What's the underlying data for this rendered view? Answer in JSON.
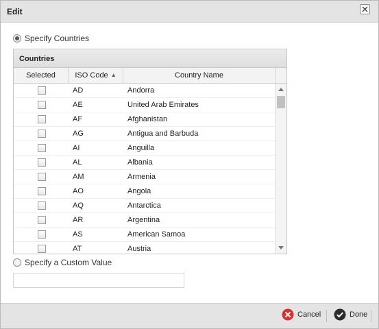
{
  "dialog": {
    "title": "Edit",
    "close_label": "close"
  },
  "options": {
    "specify_countries": "Specify Countries",
    "specify_custom": "Specify a Custom Value",
    "custom_value": ""
  },
  "grid": {
    "caption": "Countries",
    "columns": {
      "selected": "Selected",
      "iso": "ISO Code",
      "name": "Country Name"
    },
    "rows": [
      {
        "code": "AD",
        "name": "Andorra",
        "selected": false
      },
      {
        "code": "AE",
        "name": "United Arab Emirates",
        "selected": false
      },
      {
        "code": "AF",
        "name": "Afghanistan",
        "selected": false
      },
      {
        "code": "AG",
        "name": "Antigua and Barbuda",
        "selected": false
      },
      {
        "code": "AI",
        "name": "Anguilla",
        "selected": false
      },
      {
        "code": "AL",
        "name": "Albania",
        "selected": false
      },
      {
        "code": "AM",
        "name": "Armenia",
        "selected": false
      },
      {
        "code": "AO",
        "name": "Angola",
        "selected": false
      },
      {
        "code": "AQ",
        "name": "Antarctica",
        "selected": false
      },
      {
        "code": "AR",
        "name": "Argentina",
        "selected": false
      },
      {
        "code": "AS",
        "name": "American Samoa",
        "selected": false
      },
      {
        "code": "AT",
        "name": "Austria",
        "selected": false
      }
    ]
  },
  "footer": {
    "cancel_label": "Cancel",
    "done_label": "Done"
  },
  "colors": {
    "cancel_icon": "#d9312d",
    "done_icon": "#2b2b2b"
  }
}
